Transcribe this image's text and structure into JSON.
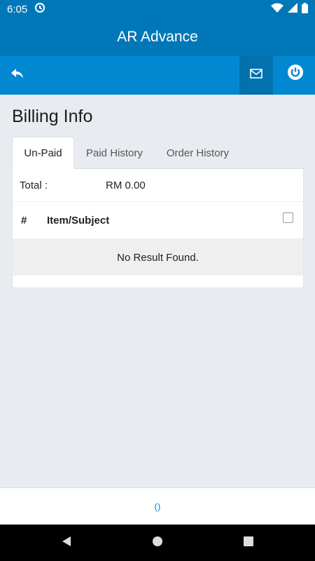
{
  "status_bar": {
    "time": "6:05"
  },
  "app": {
    "title": "AR Advance"
  },
  "toolbar": {
    "back_icon": "reply-icon",
    "mail_icon": "mail-icon",
    "power_icon": "power-icon"
  },
  "page": {
    "title": "Billing Info"
  },
  "tabs": [
    {
      "label": "Un-Paid",
      "active": true
    },
    {
      "label": "Paid History",
      "active": false
    },
    {
      "label": "Order History",
      "active": false
    }
  ],
  "billing": {
    "total_label": "Total :",
    "total_value": "RM 0.00",
    "columns": {
      "number": "#",
      "item": "Item/Subject"
    },
    "empty_message": "No Result Found."
  },
  "footer": {
    "text": "()"
  },
  "colors": {
    "primary": "#0078b8",
    "toolbar": "#0288d1",
    "background": "#e8ecf1"
  }
}
